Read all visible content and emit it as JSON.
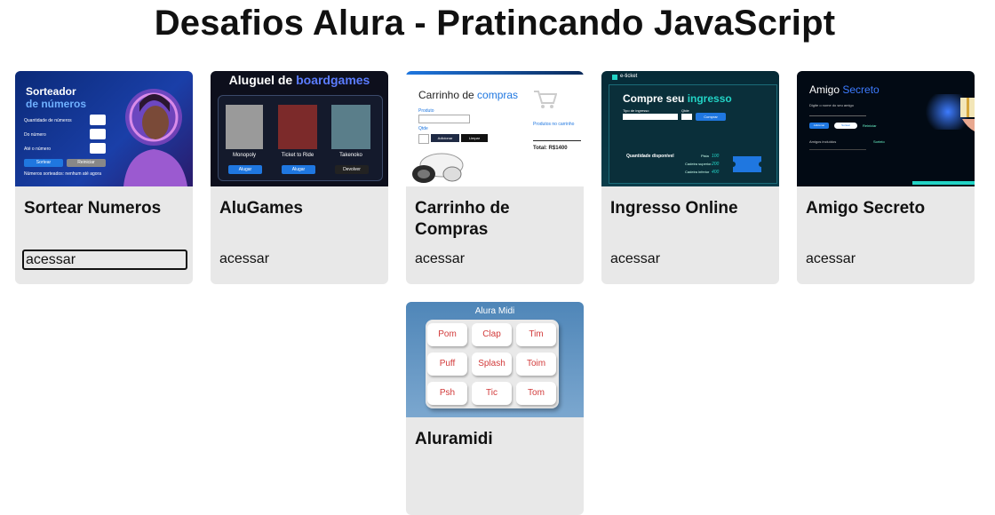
{
  "page": {
    "title": "Desafios Alura - Pratincando JavaScript"
  },
  "cards": [
    {
      "title": "Sortear Numeros",
      "link": "acessar",
      "thumb": {
        "heading_1": "Sorteador",
        "heading_2": "de números",
        "field_1": "Quantidade de números",
        "field_2": "Do número",
        "field_3": "Até o número",
        "button_1": "Sortear",
        "button_2": "Reiniciar",
        "footer": "Números sorteados: nenhum até agora"
      }
    },
    {
      "title": "AluGames",
      "link": "acessar",
      "thumb": {
        "heading_1": "Aluguel de ",
        "heading_2": "boardgames",
        "game_1": "Monopoly",
        "game_2": "Ticket to Ride",
        "game_3": "Takenoko",
        "button_1": "Alugar",
        "button_2": "Alugar",
        "button_3": "Devolver"
      }
    },
    {
      "title": "Carrinho de Compras",
      "link": "acessar",
      "thumb": {
        "heading_1": "Carrinho de ",
        "heading_2": "compras",
        "label_1": "Produto",
        "label_2": "Qtde",
        "button_1": "Adicionar",
        "button_2": "Limpar",
        "cart_label": "Produtos no carrinho",
        "total": "Total: R$1400"
      }
    },
    {
      "title": "Ingresso Online",
      "link": "acessar",
      "thumb": {
        "brand": "e-ticket",
        "heading_1": "Compre seu ",
        "heading_2": "ingresso",
        "field_1": "Tipo de ingresso",
        "field_2": "Qtde",
        "button": "Comprar",
        "section": "Quantidade disponível",
        "row_1": "Pista",
        "row_2": "Cadeira superior",
        "row_3": "Cadeira inferior",
        "val_1": "100",
        "val_2": "200",
        "val_3": "400"
      }
    },
    {
      "title": "Amigo Secreto",
      "link": "acessar",
      "thumb": {
        "heading_1": "Amigo ",
        "heading_2": "Secreto",
        "label_1": "Digite o nome do seu amigo",
        "label_2": "Amigos incluídos",
        "button_1": "Adicionar",
        "button_2": "Sortear",
        "button_3": "Reiniciar",
        "label_3": "Sorteio"
      }
    },
    {
      "title": "Aluramidi",
      "link": "acessar",
      "thumb": {
        "heading": "Alura Midi",
        "keys": [
          "Pom",
          "Clap",
          "Tim",
          "Puff",
          "Splash",
          "Toim",
          "Psh",
          "Tic",
          "Tom"
        ]
      }
    }
  ],
  "colors": {
    "card_bg": "#e8e8e8",
    "accent_blue": "#1f77e0",
    "ingresso_accent": "#22d3c5",
    "midi_key_text": "#d23a3a"
  }
}
